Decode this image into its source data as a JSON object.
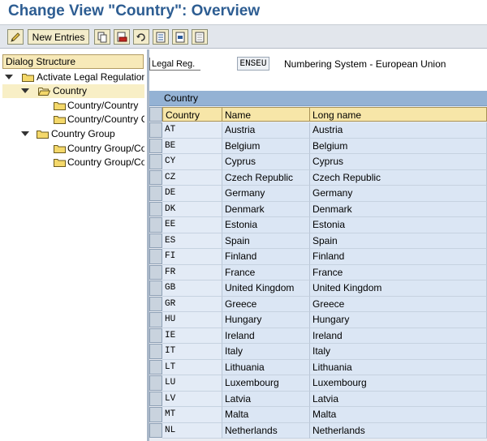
{
  "window": {
    "title": "Change View \"Country\": Overview"
  },
  "toolbar": {
    "new_entries_label": "New Entries",
    "icons": [
      "edit-icon",
      "copy-icon",
      "delete-icon",
      "undo-icon",
      "select-all-icon",
      "select-block-icon",
      "deselect-all-icon"
    ]
  },
  "dialog_structure": {
    "header": "Dialog Structure",
    "items": [
      {
        "label": "Activate Legal Regulation",
        "level": 0,
        "expanded": true
      },
      {
        "label": "Country",
        "level": 1,
        "expanded": true,
        "selected": true
      },
      {
        "label": "Country/Country",
        "level": 2
      },
      {
        "label": "Country/Country Group",
        "level": 2
      },
      {
        "label": "Country Group",
        "level": 1,
        "expanded": true
      },
      {
        "label": "Country Group/Country",
        "level": 2
      },
      {
        "label": "Country Group/Country Group",
        "level": 2
      }
    ]
  },
  "legal_reg": {
    "label": "Legal Reg.",
    "value": "ENSEU",
    "description": "Numbering System - European Union"
  },
  "table": {
    "title": "Country",
    "columns": [
      "Country",
      "Name",
      "Long name"
    ],
    "rows": [
      [
        "AT",
        "Austria",
        "Austria"
      ],
      [
        "BE",
        "Belgium",
        "Belgium"
      ],
      [
        "CY",
        "Cyprus",
        "Cyprus"
      ],
      [
        "CZ",
        "Czech Republic",
        "Czech Republic"
      ],
      [
        "DE",
        "Germany",
        "Germany"
      ],
      [
        "DK",
        "Denmark",
        "Denmark"
      ],
      [
        "EE",
        "Estonia",
        "Estonia"
      ],
      [
        "ES",
        "Spain",
        "Spain"
      ],
      [
        "FI",
        "Finland",
        "Finland"
      ],
      [
        "FR",
        "France",
        "France"
      ],
      [
        "GB",
        "United Kingdom",
        "United Kingdom"
      ],
      [
        "GR",
        "Greece",
        "Greece"
      ],
      [
        "HU",
        "Hungary",
        "Hungary"
      ],
      [
        "IE",
        "Ireland",
        "Ireland"
      ],
      [
        "IT",
        "Italy",
        "Italy"
      ],
      [
        "LT",
        "Lithuania",
        "Lithuania"
      ],
      [
        "LU",
        "Luxembourg",
        "Luxembourg"
      ],
      [
        "LV",
        "Latvia",
        "Latvia"
      ],
      [
        "MT",
        "Malta",
        "Malta"
      ],
      [
        "NL",
        "Netherlands",
        "Netherlands"
      ]
    ]
  },
  "colors": {
    "title": "#2d5d92",
    "table_header": "#94b2d4",
    "cell": "#dbe6f4",
    "column_header": "#f7e6a8"
  }
}
